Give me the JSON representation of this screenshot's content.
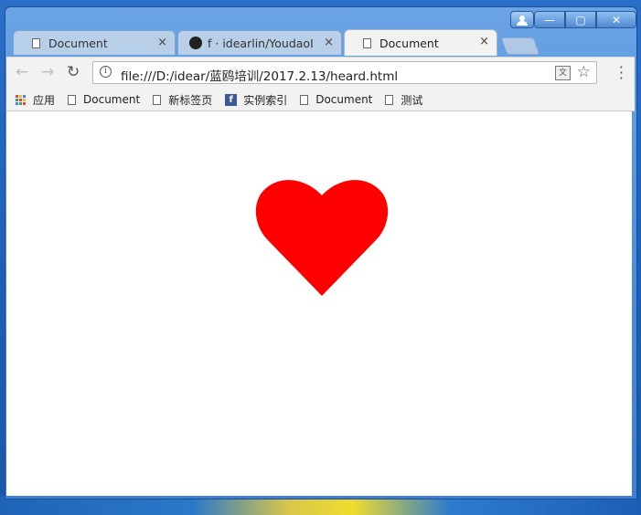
{
  "tabs": [
    {
      "label": "Document",
      "close": "×"
    },
    {
      "label": "f · idearlin/YoudaoI",
      "close": "×"
    },
    {
      "label": "Document",
      "close": "×"
    }
  ],
  "window_controls": {
    "minimize": "—",
    "maximize": "▢",
    "close": "✕"
  },
  "address_bar": {
    "url": "file:///D:/idear/蓝鸥培训/2017.2.13/heard.html"
  },
  "bookmarks": [
    {
      "label": "应用",
      "icon": "apps-icon"
    },
    {
      "label": "Document",
      "icon": "doc-icon"
    },
    {
      "label": "新标签页",
      "icon": "doc-icon"
    },
    {
      "label": "实例索引",
      "icon": "facebook-icon"
    },
    {
      "label": "Document",
      "icon": "doc-icon"
    },
    {
      "label": "测试",
      "icon": "doc-icon"
    }
  ],
  "content": {
    "heart_color": "#ff0000"
  }
}
